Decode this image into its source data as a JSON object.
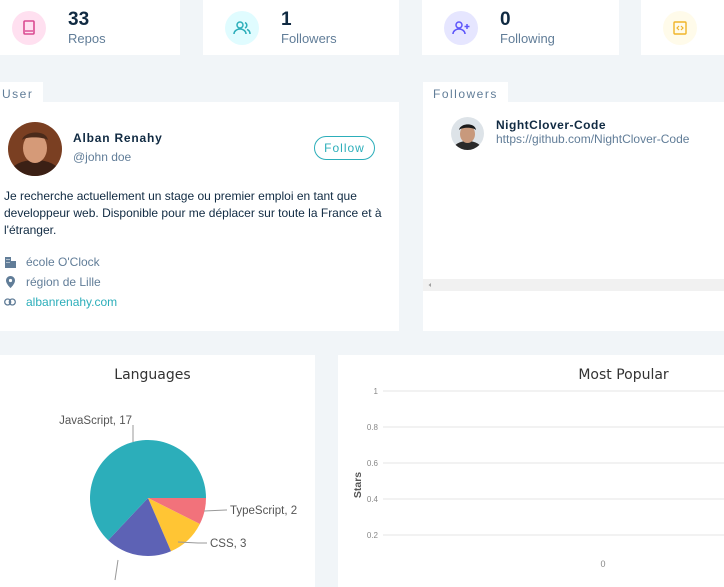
{
  "stats": [
    {
      "value": "33",
      "label": "Repos",
      "icon": "book-icon",
      "color": "#da4a91",
      "bg": "#ffe0f0"
    },
    {
      "value": "1",
      "label": "Followers",
      "icon": "users-icon",
      "color": "#2caeba",
      "bg": "#e0fcff"
    },
    {
      "value": "0",
      "label": "Following",
      "icon": "user-plus-icon",
      "color": "#5d55fa",
      "bg": "#e6e6ff"
    },
    {
      "value": "",
      "label": "",
      "icon": "code-icon",
      "color": "#f0b429",
      "bg": "#fffbea"
    }
  ],
  "user": {
    "tab": "User",
    "name": "Alban Renahy",
    "handle": "@john doe",
    "follow_label": "Follow",
    "bio": "Je recherche actuellement un stage ou premier emploi en tant que developpeur web. Disponible pour me déplacer sur toute la France et à l'étranger.",
    "company": "école O'Clock",
    "location": "région de Lille",
    "blog": "albanrenahy.com"
  },
  "followers": {
    "tab": "Followers",
    "items": [
      {
        "login": "NightClover-Code",
        "url": "https://github.com/NightClover-Code"
      }
    ]
  },
  "colors": {
    "accent": "#2caeba",
    "primary_text": "#102a42",
    "secondary_text": "#617d98"
  },
  "chart_data": [
    {
      "type": "pie",
      "title": "Languages",
      "slices": [
        {
          "label": "JavaScript",
          "value": 17,
          "color": "#2caeba"
        },
        {
          "label": "TypeScript",
          "value": 2,
          "color": "#f2727b"
        },
        {
          "label": "CSS",
          "value": 3,
          "color": "#ffc534"
        },
        {
          "label": "",
          "value": 5,
          "color": "#5d62b5"
        }
      ],
      "slice_labels": [
        "JavaScript, 17",
        "TypeScript, 2",
        "CSS, 3"
      ]
    },
    {
      "type": "bar",
      "title": "Most Popular",
      "ylabel": "Stars",
      "ylim": [
        0,
        1
      ],
      "yticks": [
        "1",
        "0.8",
        "0.6",
        "0.4",
        "0.2"
      ],
      "values": [
        0
      ],
      "value_labels": [
        "0"
      ]
    }
  ]
}
